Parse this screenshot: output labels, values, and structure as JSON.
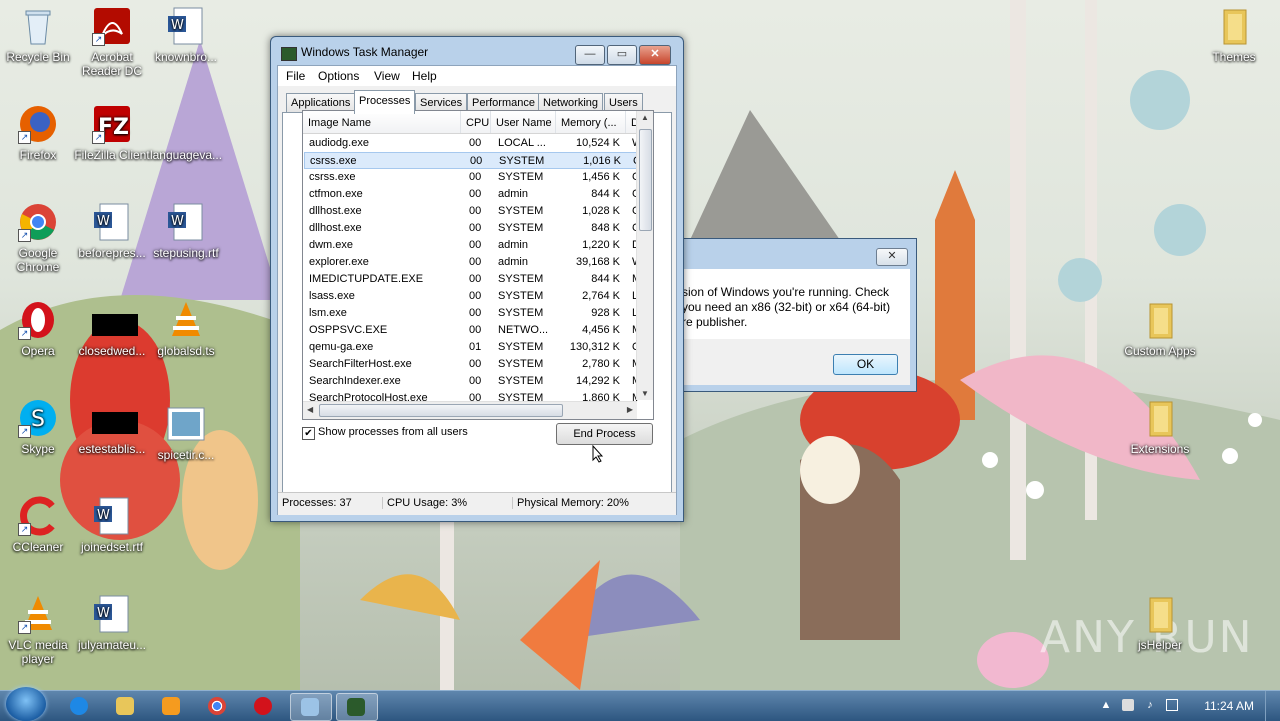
{
  "desktop": {
    "icons_left": [
      {
        "label": "Recycle Bin",
        "icon": "recycle-bin-icon"
      },
      {
        "label": "Firefox",
        "icon": "firefox-icon"
      },
      {
        "label": "Google Chrome",
        "icon": "chrome-icon"
      },
      {
        "label": "Opera",
        "icon": "opera-icon"
      },
      {
        "label": "Skype",
        "icon": "skype-icon"
      },
      {
        "label": "CCleaner",
        "icon": "ccleaner-icon"
      },
      {
        "label": "VLC media player",
        "icon": "vlc-icon"
      }
    ],
    "icons_col2": [
      {
        "label": "Acrobat Reader DC",
        "icon": "acrobat-icon"
      },
      {
        "label": "FileZilla Client",
        "icon": "filezilla-icon"
      },
      {
        "label": "beforepres...",
        "icon": "word-doc-icon"
      },
      {
        "label": "closedwed...",
        "icon": "black-file-icon"
      },
      {
        "label": "estestablis...",
        "icon": "black-file-icon"
      },
      {
        "label": "joinedset.rtf",
        "icon": "word-doc-icon"
      },
      {
        "label": "julyamateu...",
        "icon": "word-doc-icon"
      }
    ],
    "icons_col3": [
      {
        "label": "knownbro...",
        "icon": "word-doc-icon"
      },
      {
        "label": "languageva...",
        "icon": "file-icon"
      },
      {
        "label": "stepusing.rtf",
        "icon": "word-doc-icon"
      },
      {
        "label": "globalsd.ts",
        "icon": "vlc-icon"
      },
      {
        "label": "spicetir.c...",
        "icon": "image-file-icon"
      }
    ],
    "icons_right": [
      {
        "label": "Themes",
        "icon": "folder-icon"
      },
      {
        "label": "Custom Apps",
        "icon": "folder-icon"
      },
      {
        "label": "Extensions",
        "icon": "folder-icon"
      },
      {
        "label": "jsHelper",
        "icon": "folder-icon"
      }
    ],
    "watermark": "ANY RUN"
  },
  "taskmgr": {
    "title": "Windows Task Manager",
    "caption_buttons": {
      "minimize": "—",
      "maximize": "▭",
      "close": "✕"
    },
    "menu": [
      "File",
      "Options",
      "View",
      "Help"
    ],
    "tabs": [
      "Applications",
      "Processes",
      "Services",
      "Performance",
      "Networking",
      "Users"
    ],
    "active_tab": "Processes",
    "columns": [
      "Image Name",
      "CPU",
      "User Name",
      "Memory (...",
      "D"
    ],
    "sort_indicator": "▲",
    "processes": [
      {
        "name": "audiodg.exe",
        "cpu": "00",
        "user": "LOCAL ...",
        "mem": "10,524 K",
        "desc": "W"
      },
      {
        "name": "csrss.exe",
        "cpu": "00",
        "user": "SYSTEM",
        "mem": "1,016 K",
        "desc": "C"
      },
      {
        "name": "csrss.exe",
        "cpu": "00",
        "user": "SYSTEM",
        "mem": "1,456 K",
        "desc": "C"
      },
      {
        "name": "ctfmon.exe",
        "cpu": "00",
        "user": "admin",
        "mem": "844 K",
        "desc": "C"
      },
      {
        "name": "dllhost.exe",
        "cpu": "00",
        "user": "SYSTEM",
        "mem": "1,028 K",
        "desc": "C"
      },
      {
        "name": "dllhost.exe",
        "cpu": "00",
        "user": "SYSTEM",
        "mem": "848 K",
        "desc": "C"
      },
      {
        "name": "dwm.exe",
        "cpu": "00",
        "user": "admin",
        "mem": "1,220 K",
        "desc": "D"
      },
      {
        "name": "explorer.exe",
        "cpu": "00",
        "user": "admin",
        "mem": "39,168 K",
        "desc": "W"
      },
      {
        "name": "IMEDICTUPDATE.EXE",
        "cpu": "00",
        "user": "SYSTEM",
        "mem": "844 K",
        "desc": "M"
      },
      {
        "name": "lsass.exe",
        "cpu": "00",
        "user": "SYSTEM",
        "mem": "2,764 K",
        "desc": "L"
      },
      {
        "name": "lsm.exe",
        "cpu": "00",
        "user": "SYSTEM",
        "mem": "928 K",
        "desc": "L"
      },
      {
        "name": "OSPPSVC.EXE",
        "cpu": "00",
        "user": "NETWO...",
        "mem": "4,456 K",
        "desc": "M"
      },
      {
        "name": "qemu-ga.exe",
        "cpu": "01",
        "user": "SYSTEM",
        "mem": "130,312 K",
        "desc": "Q"
      },
      {
        "name": "SearchFilterHost.exe",
        "cpu": "00",
        "user": "SYSTEM",
        "mem": "2,780 K",
        "desc": "M"
      },
      {
        "name": "SearchIndexer.exe",
        "cpu": "00",
        "user": "SYSTEM",
        "mem": "14,292 K",
        "desc": "M"
      },
      {
        "name": "SearchProtocolHost.exe",
        "cpu": "00",
        "user": "SYSTEM",
        "mem": "1,860 K",
        "desc": "M"
      }
    ],
    "selected_index": 1,
    "show_all_users_label": "Show processes from all users",
    "show_all_users_checked": "✔",
    "end_process_label": "End Process",
    "status": {
      "processes": "Processes: 37",
      "cpu": "CPU Usage: 3%",
      "memory": "Physical Memory: 20%"
    }
  },
  "dialog": {
    "close_label": "✕",
    "lines": [
      "sion of Windows you're running. Check",
      "you need an x86 (32-bit) or x64 (64-bit)",
      "re publisher."
    ],
    "ok_label": "OK"
  },
  "taskbar": {
    "clock": "11:24 AM",
    "pinned": [
      "internet-explorer-icon",
      "explorer-folder-icon",
      "media-player-icon",
      "chrome-icon",
      "opera-icon",
      "remote-desktop-icon",
      "task-manager-icon"
    ],
    "tray": [
      "show-hidden-icons-arrow",
      "action-center-icon",
      "volume-icon",
      "network-icon",
      "flag-icon"
    ]
  },
  "colors": {
    "window_frame": "#b9d1ea",
    "selection": "#dbeafb",
    "taskbar": "#2d5680"
  }
}
